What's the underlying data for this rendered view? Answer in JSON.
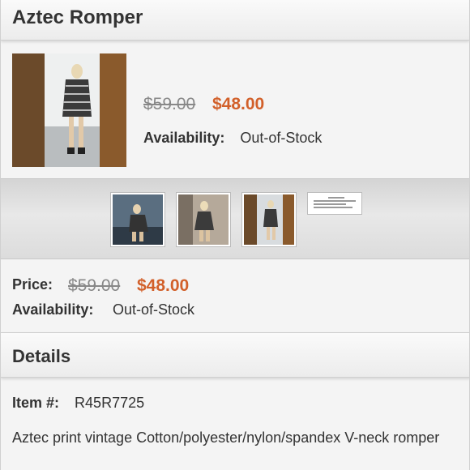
{
  "product": {
    "title": "Aztec Romper",
    "old_price": "$59.00",
    "new_price": "$48.00",
    "availability_label": "Availability:",
    "availability_value": "Out-of-Stock"
  },
  "price_section": {
    "price_label": "Price:",
    "old_price": "$59.00",
    "new_price": "$48.00",
    "availability_label": "Availability:",
    "availability_value": "Out-of-Stock"
  },
  "details": {
    "heading": "Details",
    "item_label": "Item #:",
    "item_value": "R45R7725",
    "description": "Aztec print vintage Cotton/polyester/nylon/spandex V-neck romper"
  },
  "thumbnails": [
    {
      "icon": "photo-icon"
    },
    {
      "icon": "photo-icon"
    },
    {
      "icon": "photo-icon"
    },
    {
      "icon": "document-icon"
    }
  ],
  "colors": {
    "sale_price": "#d2602a",
    "old_price": "#888888",
    "text": "#333333"
  }
}
